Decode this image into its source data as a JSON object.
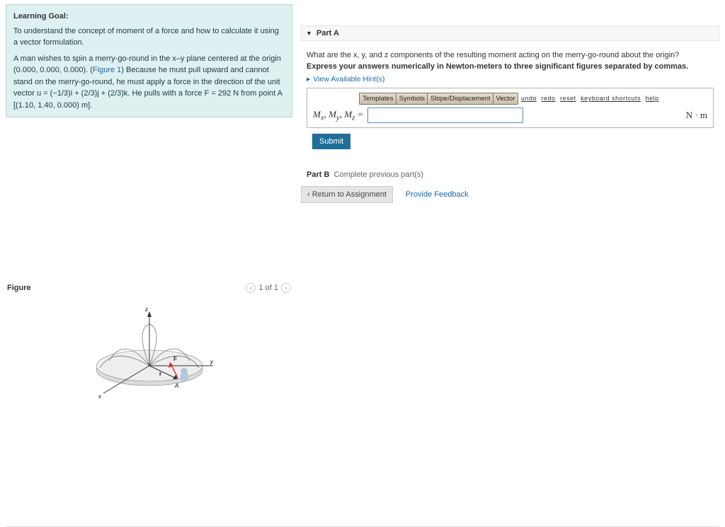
{
  "learning_goal": {
    "heading": "Learning Goal:",
    "intro": "To understand the concept of moment of a force and how to calculate it using a vector formulation.",
    "para": "A man wishes to spin a merry-go-round in the x–y plane centered at the origin (0.000, 0.000, 0.000). (",
    "fig_link": "Figure 1",
    "para2": ") Because he must pull upward and cannot stand on the merry-go-round, he must apply a force in the direction of the unit vector u = (−1/3)i + (2/3)j + (2/3)k. He pulls with a force F = 292 N from point A [(1.10, 1.40, 0.000) m]."
  },
  "figure": {
    "label": "Figure",
    "counter": "1 of 1",
    "prev": "‹",
    "next": "›",
    "axes": {
      "z": "z",
      "y": "y",
      "x": "x"
    },
    "point_A": "A",
    "vec_r": "r",
    "vec_F": "F"
  },
  "partA": {
    "title": "Part A",
    "question": "What are the x, y, and z components of the resulting moment acting on the merry-go-round about the origin?",
    "instruction": "Express your answers numerically in Newton-meters to three significant figures separated by commas.",
    "hints": "View Available Hint(s)",
    "toolbar": {
      "templates": "Templates",
      "symbols": "Symbols",
      "slope": "Slope/Displacement",
      "vector": "Vector",
      "undo": "undo",
      "redo": "redo",
      "reset": "reset",
      "keyboard": "keyboard shortcuts",
      "help": "help"
    },
    "prompt_label": "Mx, My, Mz =",
    "answer_value": "",
    "unit": "N · m",
    "submit": "Submit"
  },
  "partB": {
    "label": "Part B",
    "status": "Complete previous part(s)"
  },
  "bottom": {
    "return": "Return to Assignment",
    "feedback": "Provide Feedback"
  }
}
